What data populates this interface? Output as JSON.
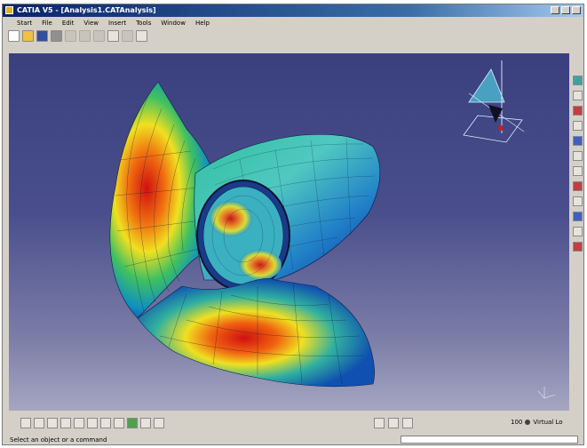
{
  "window": {
    "title": "CATIA V5 - [Analysis1.CATAnalysis]"
  },
  "menubar": {
    "items": [
      "Start",
      "File",
      "Edit",
      "View",
      "Insert",
      "Tools",
      "Window",
      "Help"
    ]
  },
  "toolbar": {
    "icons": [
      "new-icon",
      "open-icon",
      "save-icon",
      "print-icon",
      "cut-icon",
      "copy-icon",
      "paste-icon",
      "undo-icon",
      "redo-icon",
      "whats-this-icon"
    ]
  },
  "right_toolbar": {
    "icons": [
      "tool-a",
      "tool-b",
      "tool-c",
      "tool-d",
      "tool-e",
      "tool-f",
      "tool-g",
      "tool-h",
      "tool-i",
      "tool-j",
      "tool-k",
      "tool-l"
    ]
  },
  "bottom_toolbar": {
    "icons": [
      "fly-icon",
      "fit-all-icon",
      "pan-icon",
      "rotate-icon",
      "zoom-in-icon",
      "zoom-out-icon",
      "normal-view-icon",
      "view-icon",
      "render-icon",
      "hide-show-icon",
      "swap-icon"
    ]
  },
  "zoom_readout": {
    "value": "100",
    "label": "Virtual Lo"
  },
  "status": {
    "message": "Select an object or a command"
  },
  "colors": {
    "viewport_top": "#3a3f7e",
    "viewport_bottom": "#a6a6c2",
    "title_bar": "#0a246a"
  }
}
